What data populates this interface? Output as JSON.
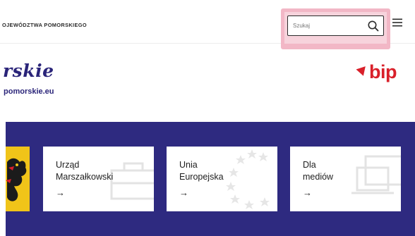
{
  "header": {
    "title": "OJEWÓDZTWA POMORSKIEGO",
    "search_placeholder": "Szukaj",
    "search_value": "",
    "search_icon": "search-icon",
    "menu_icon": "hamburger-menu-icon"
  },
  "branding": {
    "logo_script": "rskie",
    "domain": "pomorskie.eu",
    "bip_label": "bip",
    "brand_color": "#2a2479",
    "bip_color": "#d9202a"
  },
  "highlight_color": "#f2b7c6",
  "band": {
    "background": "#2e2a80",
    "cards": [
      {
        "label": "Urząd\nMarszałkowski",
        "arrow": "→",
        "watermark_icon": "briefcase-icon"
      },
      {
        "label": "Unia\nEuropejska",
        "arrow": "→",
        "watermark_icon": "eu-stars-icon"
      },
      {
        "label": "Dla\nmediów",
        "arrow": "→",
        "watermark_icon": "laptop-icon"
      }
    ]
  }
}
